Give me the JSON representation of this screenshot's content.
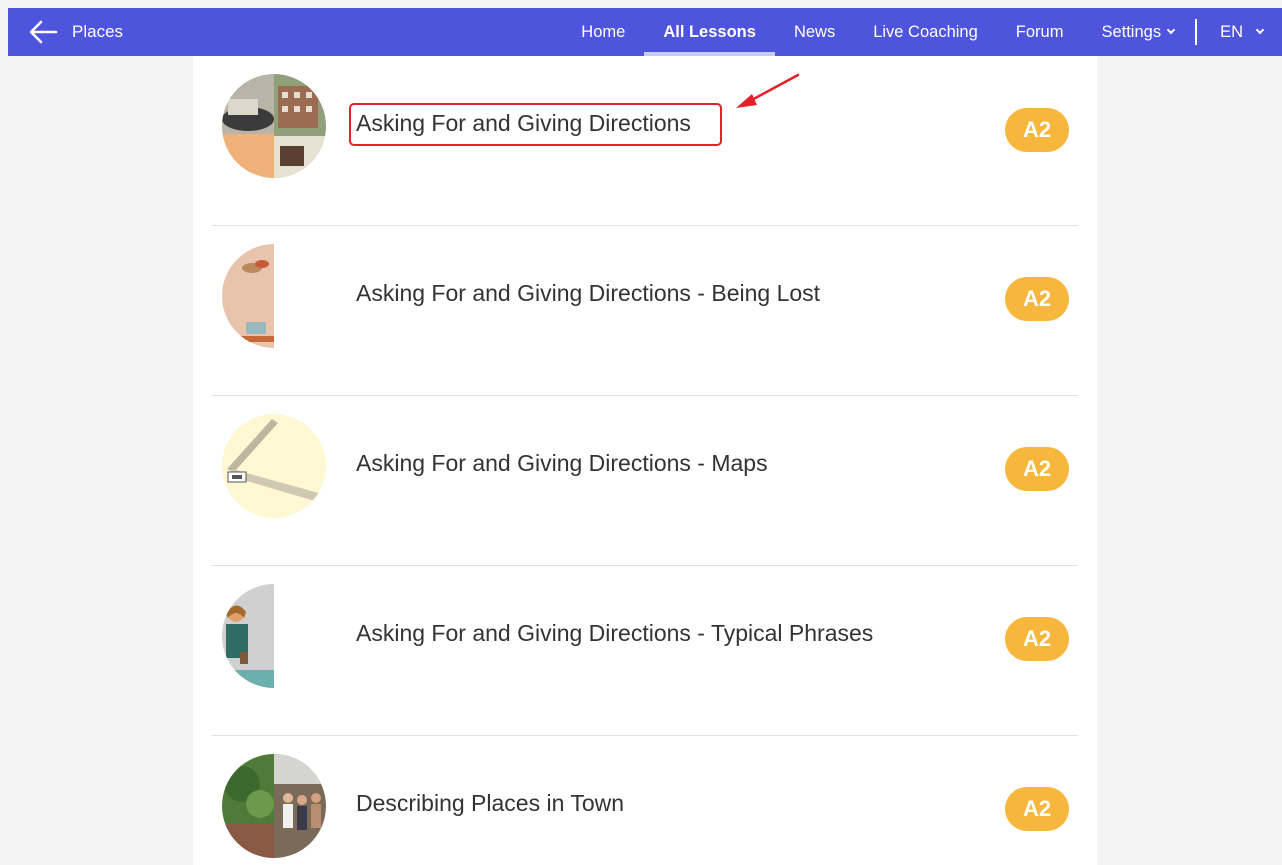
{
  "header": {
    "back_label": "Places",
    "nav": [
      {
        "label": "Home"
      },
      {
        "label": "All Lessons"
      },
      {
        "label": "News"
      },
      {
        "label": "Live Coaching"
      },
      {
        "label": "Forum"
      },
      {
        "label": "Settings"
      },
      {
        "label": "EN"
      }
    ],
    "active_nav": "All Lessons",
    "color": "#4f54dc"
  },
  "lessons": [
    {
      "title": "Asking For and Giving Directions",
      "level": "A2",
      "highlighted": true
    },
    {
      "title": "Asking For and Giving Directions - Being Lost",
      "level": "A2"
    },
    {
      "title": "Asking For and Giving Directions - Maps",
      "level": "A2"
    },
    {
      "title": "Asking For and Giving Directions - Typical Phrases",
      "level": "A2"
    },
    {
      "title": "Describing Places in Town",
      "level": "A2"
    }
  ],
  "colors": {
    "badge": "#f6b73c",
    "highlight": "#e3212b",
    "background": "#f3f3f4"
  }
}
